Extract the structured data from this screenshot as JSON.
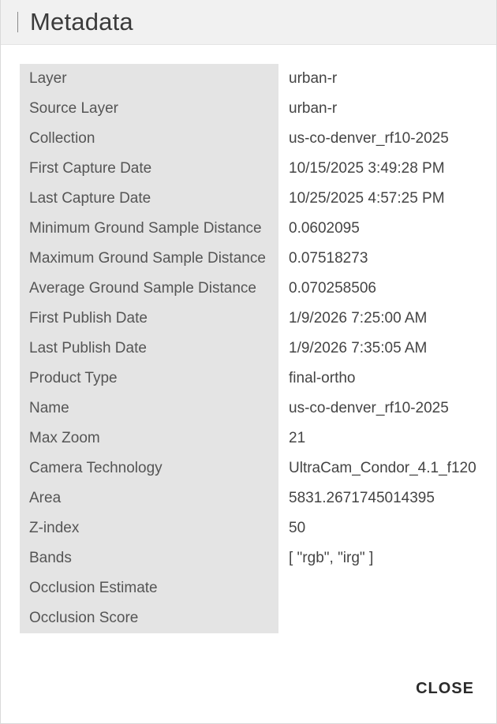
{
  "dialog": {
    "title": "Metadata",
    "close_label": "CLOSE"
  },
  "rows": [
    {
      "key": "Layer",
      "value": "urban-r"
    },
    {
      "key": "Source Layer",
      "value": "urban-r"
    },
    {
      "key": "Collection",
      "value": "us-co-denver_rf10-2025"
    },
    {
      "key": "First Capture Date",
      "value": "10/15/2025 3:49:28 PM"
    },
    {
      "key": "Last Capture Date",
      "value": "10/25/2025 4:57:25 PM"
    },
    {
      "key": "Minimum Ground Sample Distance",
      "value": "0.0602095"
    },
    {
      "key": "Maximum Ground Sample Distance",
      "value": "0.07518273"
    },
    {
      "key": "Average Ground Sample Distance",
      "value": "0.070258506"
    },
    {
      "key": "First Publish Date",
      "value": "1/9/2026 7:25:00 AM"
    },
    {
      "key": "Last Publish Date",
      "value": "1/9/2026 7:35:05 AM"
    },
    {
      "key": "Product Type",
      "value": "final-ortho"
    },
    {
      "key": "Name",
      "value": "us-co-denver_rf10-2025"
    },
    {
      "key": "Max Zoom",
      "value": "21"
    },
    {
      "key": "Camera Technology",
      "value": "UltraCam_Condor_4.1_f120"
    },
    {
      "key": "Area",
      "value": "5831.2671745014395"
    },
    {
      "key": "Z-index",
      "value": "50"
    },
    {
      "key": "Bands",
      "value": "[ \"rgb\", \"irg\" ]"
    },
    {
      "key": "Occlusion Estimate",
      "value": ""
    },
    {
      "key": "Occlusion Score",
      "value": ""
    }
  ]
}
